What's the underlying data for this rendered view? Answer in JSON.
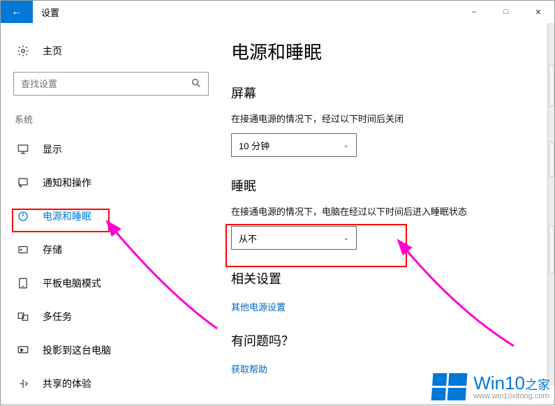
{
  "titlebar": {
    "title": "设置"
  },
  "sidebar": {
    "home": "主页",
    "search_placeholder": "查找设置",
    "group": "系统",
    "items": [
      {
        "label": "显示"
      },
      {
        "label": "通知和操作"
      },
      {
        "label": "电源和睡眠"
      },
      {
        "label": "存储"
      },
      {
        "label": "平板电脑模式"
      },
      {
        "label": "多任务"
      },
      {
        "label": "投影到这台电脑"
      },
      {
        "label": "共享的体验"
      }
    ]
  },
  "main": {
    "title": "电源和睡眠",
    "screen": {
      "heading": "屏幕",
      "desc": "在接通电源的情况下，经过以下时间后关闭",
      "value": "10 分钟"
    },
    "sleep": {
      "heading": "睡眠",
      "desc": "在接通电源的情况下，电脑在经过以下时间后进入睡眠状态",
      "value": "从不"
    },
    "related": {
      "heading": "相关设置",
      "link": "其他电源设置"
    },
    "help": {
      "heading": "有问题吗？",
      "link": "获取帮助"
    }
  },
  "watermark": {
    "brand_main": "Win10",
    "brand_sub": "之家",
    "url": "www.win10xitong.com"
  }
}
